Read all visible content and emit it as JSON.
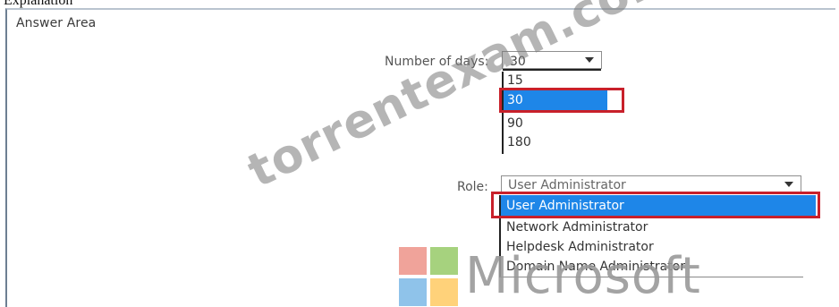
{
  "caption": "Explanation",
  "answer_area": {
    "title": "Answer Area"
  },
  "number_of_days": {
    "label": "Number of days:",
    "selected": "30",
    "options": [
      "15",
      "30",
      "90",
      "180"
    ],
    "highlighted": "30"
  },
  "role": {
    "label": "Role:",
    "selected": "User Administrator",
    "options": [
      "User Administrator",
      "Network Administrator",
      "Helpdesk Administrator",
      "Domain Name Administrator"
    ],
    "highlighted": "User Administrator"
  },
  "logo": {
    "word": "Microsoft",
    "colors": [
      "#f25022",
      "#7fba00",
      "#00a4ef",
      "#ffb900"
    ]
  },
  "watermark": "torrentexam.com",
  "colors": {
    "selection": "#1e86e8",
    "highlight_box": "#c8202a"
  }
}
